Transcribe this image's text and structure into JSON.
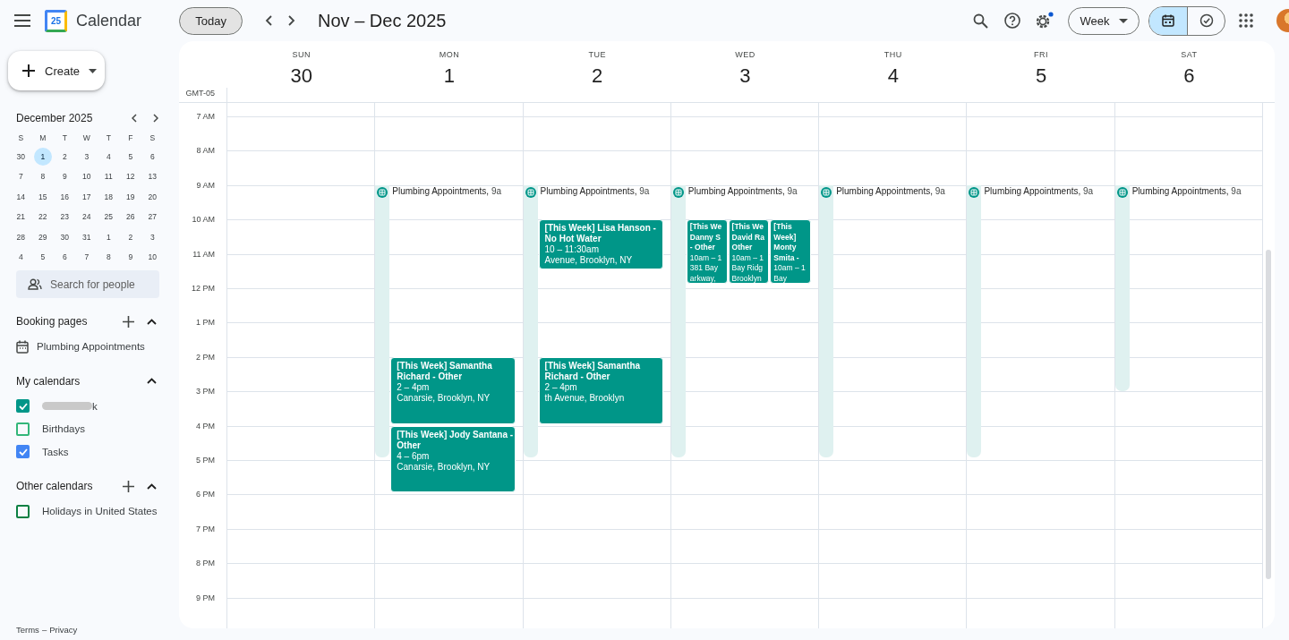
{
  "topbar": {
    "app_name": "Calendar",
    "logo_text": "25",
    "today": "Today",
    "title": "Nov – Dec 2025",
    "view": "Week",
    "view_toggle": [
      {
        "kind": "calendar",
        "selected": true
      },
      {
        "kind": "tasks",
        "selected": false
      }
    ],
    "settings_dot": true
  },
  "sidebar": {
    "create": "Create",
    "mini_calendar": {
      "title": "December 2025",
      "weekdays": [
        "S",
        "M",
        "T",
        "W",
        "T",
        "F",
        "S"
      ],
      "weeks": [
        [
          {
            "d": "30",
            "selected": false
          },
          {
            "d": "1",
            "selected": true
          },
          {
            "d": "2",
            "selected": false
          },
          {
            "d": "3",
            "selected": false
          },
          {
            "d": "4",
            "selected": false
          },
          {
            "d": "5",
            "selected": false
          },
          {
            "d": "6",
            "selected": false
          }
        ],
        [
          {
            "d": "7",
            "selected": false
          },
          {
            "d": "8",
            "selected": false
          },
          {
            "d": "9",
            "selected": false
          },
          {
            "d": "10",
            "selected": false
          },
          {
            "d": "11",
            "selected": false
          },
          {
            "d": "12",
            "selected": false
          },
          {
            "d": "13",
            "selected": false
          }
        ],
        [
          {
            "d": "14",
            "selected": false
          },
          {
            "d": "15",
            "selected": false
          },
          {
            "d": "16",
            "selected": false
          },
          {
            "d": "17",
            "selected": false
          },
          {
            "d": "18",
            "selected": false
          },
          {
            "d": "19",
            "selected": false
          },
          {
            "d": "20",
            "selected": false
          }
        ],
        [
          {
            "d": "21",
            "selected": false
          },
          {
            "d": "22",
            "selected": false
          },
          {
            "d": "23",
            "selected": false
          },
          {
            "d": "24",
            "selected": false
          },
          {
            "d": "25",
            "selected": false
          },
          {
            "d": "26",
            "selected": false
          },
          {
            "d": "27",
            "selected": false
          }
        ],
        [
          {
            "d": "28",
            "selected": false
          },
          {
            "d": "29",
            "selected": false
          },
          {
            "d": "30",
            "selected": false
          },
          {
            "d": "31",
            "selected": false
          },
          {
            "d": "1",
            "selected": false
          },
          {
            "d": "2",
            "selected": false
          },
          {
            "d": "3",
            "selected": false
          }
        ],
        [
          {
            "d": "4",
            "selected": false
          },
          {
            "d": "5",
            "selected": false
          },
          {
            "d": "6",
            "selected": false
          },
          {
            "d": "7",
            "selected": false
          },
          {
            "d": "8",
            "selected": false
          },
          {
            "d": "9",
            "selected": false
          },
          {
            "d": "10",
            "selected": false
          }
        ]
      ]
    },
    "search_people": {
      "placeholder": "Search for people"
    },
    "sections": [
      {
        "title": "Booking pages",
        "addable": true,
        "expanded": true,
        "items": [
          {
            "kind": "booking",
            "label": "Plumbing Appointments"
          }
        ]
      },
      {
        "title": "My calendars",
        "addable": false,
        "expanded": true,
        "items": [
          {
            "kind": "checkbox",
            "label": "k",
            "redacted": true,
            "checked": true,
            "color": "#009688"
          },
          {
            "kind": "checkbox",
            "label": "Birthdays",
            "redacted": false,
            "checked": false,
            "color": "#33b679"
          },
          {
            "kind": "checkbox",
            "label": "Tasks",
            "redacted": false,
            "checked": true,
            "color": "#4285f4"
          }
        ]
      },
      {
        "title": "Other calendars",
        "addable": true,
        "expanded": true,
        "items": [
          {
            "kind": "checkbox",
            "label": "Holidays in United States",
            "redacted": false,
            "checked": false,
            "color": "#0b8043"
          }
        ]
      }
    ],
    "footer": {
      "links": [
        "Terms",
        "Privacy"
      ],
      "separator": "–"
    }
  },
  "week": {
    "timezone": "GMT-05",
    "hours": [
      "7 AM",
      "8 AM",
      "9 AM",
      "10 AM",
      "11 AM",
      "12 PM",
      "1 PM",
      "2 PM",
      "3 PM",
      "4 PM",
      "5 PM",
      "6 PM",
      "7 PM",
      "8 PM",
      "9 PM"
    ],
    "days": [
      {
        "name": "SUN",
        "date": "30"
      },
      {
        "name": "MON",
        "date": "1",
        "booking": {
          "label": "Plumbing Appointments,",
          "time": "9a",
          "ends_early": false
        },
        "events": [
          {
            "title_lines": [
              "[This Week] Samantha",
              "Richard - Other"
            ],
            "detail_lines": [
              "2 – 4pm",
              "Canarsie, Brooklyn, NY"
            ]
          },
          {
            "title_lines": [
              "[This Week] Jody Santana -",
              "Other"
            ],
            "detail_lines": [
              "4 – 6pm",
              "Canarsie, Brooklyn, NY"
            ]
          }
        ]
      },
      {
        "name": "TUE",
        "date": "2",
        "booking": {
          "label": "Plumbing Appointments,",
          "time": "9a",
          "ends_early": false
        },
        "events": [
          {
            "title_lines": [
              "[This Week] Lisa Hanson -",
              "No Hot Water"
            ],
            "detail_lines": [
              "10 – 11:30am",
              "Avenue, Brooklyn, NY"
            ]
          },
          {
            "title_lines": [
              "[This Week] Samantha",
              "Richard - Other"
            ],
            "detail_lines": [
              "2 – 4pm",
              "th Avenue, Brooklyn"
            ]
          }
        ]
      },
      {
        "name": "WED",
        "date": "3",
        "booking": {
          "label": "Plumbing Appointments,",
          "time": "9a",
          "ends_early": false
        },
        "events": [
          {
            "title_lines": [
              "[This We",
              "Danny S",
              "- Other"
            ],
            "detail_lines": [
              "10am – 1",
              "381 Bay",
              "arkway,"
            ]
          },
          {
            "title_lines": [
              "[This We",
              "David Ra",
              "Other"
            ],
            "detail_lines": [
              "10am – 1",
              "Bay Ridg",
              "Brooklyn"
            ]
          },
          {
            "title_lines": [
              "[This",
              "Week]",
              "Monty",
              "Smita -"
            ],
            "detail_lines": [
              "10am – 1",
              "Bay"
            ]
          }
        ]
      },
      {
        "name": "THU",
        "date": "4",
        "booking": {
          "label": "Plumbing Appointments,",
          "time": "9a",
          "ends_early": false
        }
      },
      {
        "name": "FRI",
        "date": "5",
        "booking": {
          "label": "Plumbing Appointments,",
          "time": "9a",
          "ends_early": false
        }
      },
      {
        "name": "SAT",
        "date": "6",
        "booking": {
          "label": "Plumbing Appointments,",
          "time": "9a",
          "ends_early": true
        }
      }
    ]
  }
}
